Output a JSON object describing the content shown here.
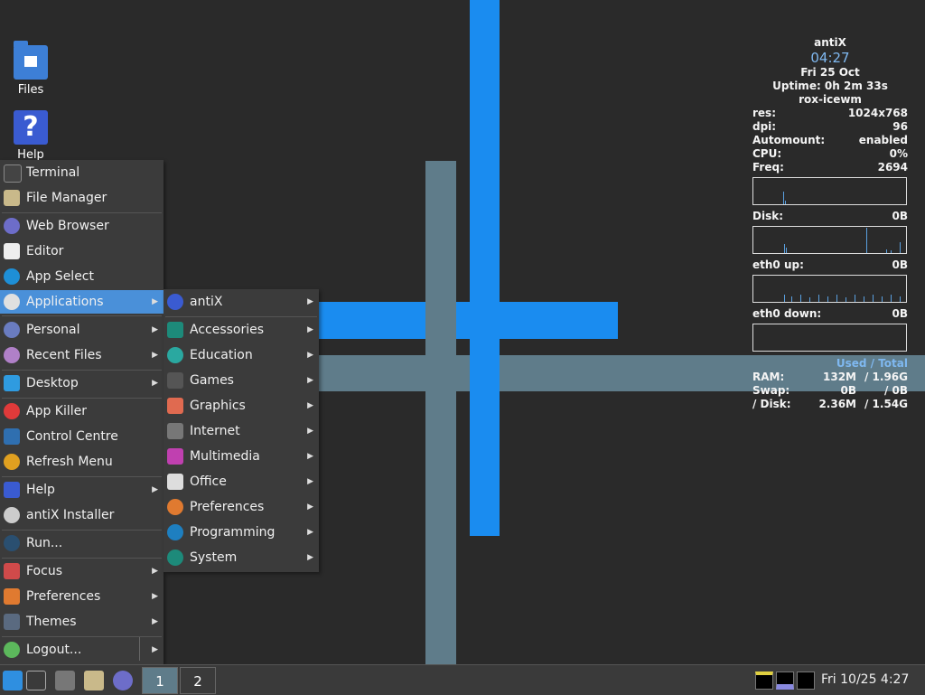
{
  "desktop": {
    "icons": [
      {
        "label": "Files"
      },
      {
        "label": "Help"
      }
    ]
  },
  "main_menu": {
    "items": [
      {
        "label": "Terminal"
      },
      {
        "label": "File Manager"
      },
      {
        "label": "Web Browser"
      },
      {
        "label": "Editor"
      },
      {
        "label": "App Select"
      },
      {
        "label": "Applications"
      },
      {
        "label": "Personal"
      },
      {
        "label": "Recent Files"
      },
      {
        "label": "Desktop"
      },
      {
        "label": "App Killer"
      },
      {
        "label": "Control Centre"
      },
      {
        "label": "Refresh Menu"
      },
      {
        "label": "Help"
      },
      {
        "label": "antiX Installer"
      },
      {
        "label": "Run..."
      },
      {
        "label": "Focus"
      },
      {
        "label": "Preferences"
      },
      {
        "label": "Themes"
      },
      {
        "label": "Logout..."
      }
    ]
  },
  "applications_menu": {
    "items": [
      {
        "label": "antiX"
      },
      {
        "label": "Accessories"
      },
      {
        "label": "Education"
      },
      {
        "label": "Games"
      },
      {
        "label": "Graphics"
      },
      {
        "label": "Internet"
      },
      {
        "label": "Multimedia"
      },
      {
        "label": "Office"
      },
      {
        "label": "Preferences"
      },
      {
        "label": "Programming"
      },
      {
        "label": "System"
      }
    ]
  },
  "conky": {
    "hostname": "antiX",
    "time": "04:27",
    "date": "Fri 25 Oct",
    "uptime": "Uptime: 0h 2m 33s",
    "session": "rox-icewm",
    "res_label": "res:",
    "res_value": "1024x768",
    "dpi_label": "dpi:",
    "dpi_value": "96",
    "automount_label": "Automount:",
    "automount_value": "enabled",
    "cpu_label": "CPU:",
    "cpu_value": "0%",
    "freq_label": "Freq:",
    "freq_value": "2694",
    "disk_label": "Disk:",
    "disk_value": "0B",
    "eth_up_label": "eth0 up:",
    "eth_up_value": "0B",
    "eth_down_label": "eth0 down:",
    "eth_down_value": "0B",
    "used_total": "Used / Total",
    "ram_label": "RAM:",
    "ram_used": "132M",
    "ram_total": "/ 1.96G",
    "swap_label": "Swap:",
    "swap_used": "0B",
    "swap_total": "/ 0B",
    "fs_label": "/ Disk:",
    "fs_used": "2.36M",
    "fs_total": "/ 1.54G"
  },
  "taskbar": {
    "workspaces": [
      "1",
      "2"
    ],
    "clock": "Fri 10/25  4:27"
  },
  "colors": {
    "accent": "#4a90d9",
    "wallpaper_blue": "#1a8cf0",
    "wallpaper_grey": "#5f7c8a"
  }
}
